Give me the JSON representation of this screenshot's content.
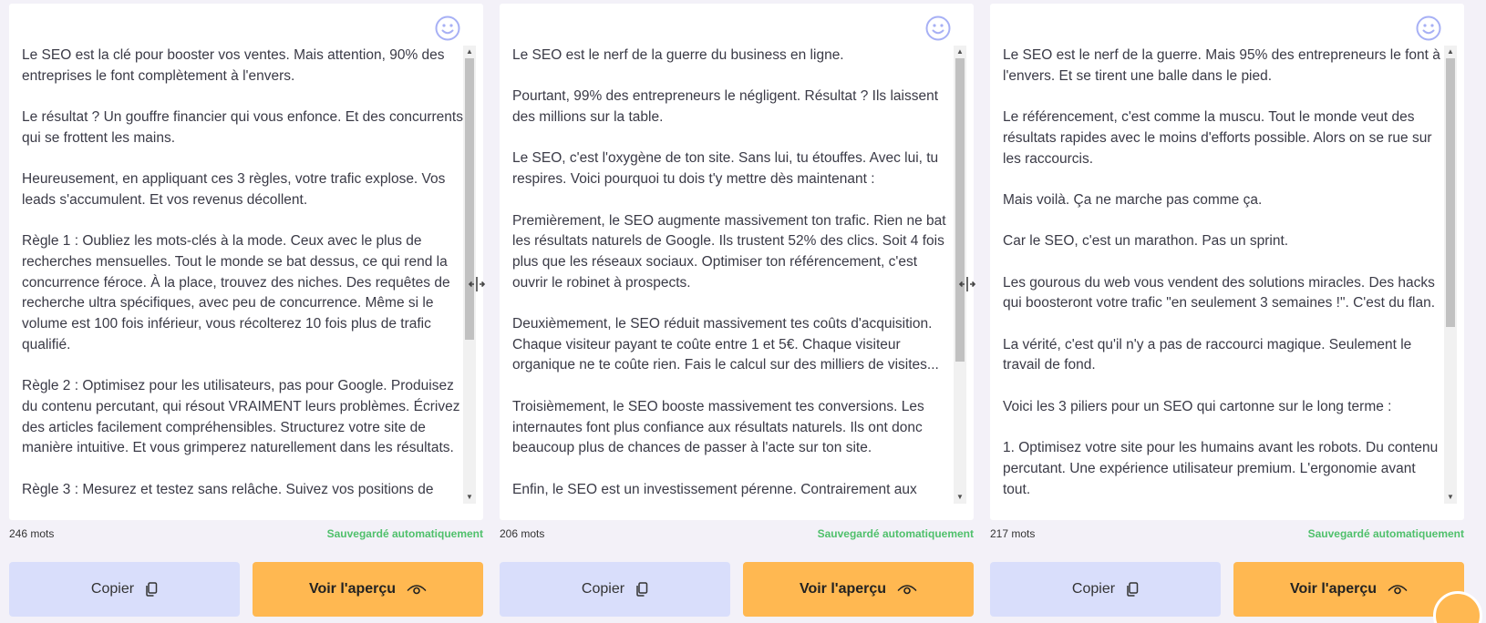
{
  "columns": [
    {
      "paragraphs": [
        "Le SEO est la clé pour booster vos ventes. Mais attention, 90% des entreprises le font complètement à l'envers.",
        "Le résultat ? Un gouffre financier qui vous enfonce. Et des concurrents qui se frottent les mains.",
        "Heureusement, en appliquant ces 3 règles, votre trafic explose. Vos leads s'accumulent. Et vos revenus décollent.",
        "Règle 1 : Oubliez les mots-clés à la mode. Ceux avec le plus de recherches mensuelles. Tout le monde se bat dessus, ce qui rend la concurrence féroce. À la place, trouvez des niches. Des requêtes de recherche ultra spécifiques, avec peu de concurrence. Même si le volume est 100 fois inférieur, vous récolterez 10 fois plus de trafic qualifié.",
        "Règle 2 : Optimisez pour les utilisateurs, pas pour Google. Produisez du contenu percutant, qui résout VRAIMENT leurs problèmes. Écrivez des articles facilement compréhensibles. Structurez votre site de manière intuitive. Et vous grimperez naturellement dans les résultats.",
        "Règle 3 : Mesurez et testez sans relâche. Suivez vos positions de"
      ],
      "word_count": "246 mots",
      "saved_label": "Sauvegardé automatiquement",
      "copy_label": "Copier",
      "preview_label": "Voir l'aperçu",
      "scroll_position": 0.0,
      "scroll_visible_fraction": 0.65
    },
    {
      "paragraphs": [
        "Le SEO est le nerf de la guerre du business en ligne.",
        "Pourtant, 99% des entrepreneurs le négligent. Résultat ? Ils laissent des millions sur la table.",
        "Le SEO, c'est l'oxygène de ton site. Sans lui, tu étouffes. Avec lui, tu respires. Voici pourquoi tu dois t'y mettre dès maintenant :",
        "Premièrement, le SEO augmente massivement ton trafic. Rien ne bat les résultats naturels de Google. Ils trustent 52% des clics. Soit 4 fois plus que les réseaux sociaux. Optimiser ton référencement, c'est ouvrir le robinet à prospects.",
        "Deuxièmement, le SEO réduit massivement tes coûts d'acquisition. Chaque visiteur payant te coûte entre 1 et 5€. Chaque visiteur organique ne te coûte rien. Fais le calcul sur des milliers de visites...",
        "Troisièmement, le SEO booste massivement tes conversions. Les internautes font plus confiance aux résultats naturels. Ils ont donc beaucoup plus de chances de passer à l'acte sur ton site.",
        "Enfin, le SEO est un investissement pérenne. Contrairement aux"
      ],
      "word_count": "206 mots",
      "saved_label": "Sauvegardé automatiquement",
      "copy_label": "Copier",
      "preview_label": "Voir l'aperçu",
      "scroll_position": 0.0,
      "scroll_visible_fraction": 0.7
    },
    {
      "paragraphs": [
        "Le SEO est le nerf de la guerre. Mais 95% des entrepreneurs le font à l'envers. Et se tirent une balle dans le pied.",
        "Le référencement, c'est comme la muscu. Tout le monde veut des résultats rapides avec le moins d'efforts possible. Alors on se rue sur les raccourcis.",
        "Mais voilà. Ça ne marche pas comme ça.",
        "Car le SEO, c'est un marathon. Pas un sprint.",
        "Les gourous du web vous vendent des solutions miracles. Des hacks qui boosteront votre trafic \"en seulement 3 semaines !\". C'est du flan.",
        "La vérité, c'est qu'il n'y a pas de raccourci magique. Seulement le travail de fond.",
        "Voici les 3 piliers pour un SEO qui cartonne sur le long terme :",
        "1. Optimisez votre site pour les humains avant les robots. Du contenu percutant. Une expérience utilisateur premium. L'ergonomie avant tout."
      ],
      "word_count": "217 mots",
      "saved_label": "Sauvegardé automatiquement",
      "copy_label": "Copier",
      "preview_label": "Voir l'aperçu",
      "scroll_position": 0.0,
      "scroll_visible_fraction": 0.62
    }
  ],
  "icons": {
    "feedback": "smiley-icon",
    "resize": "column-resize-icon",
    "copy": "copy-icon",
    "preview": "eye-icon"
  },
  "colors": {
    "background": "#f3f1f8",
    "copy_button": "#d9defb",
    "preview_button": "#ffb851",
    "saved_text": "#4fc06b",
    "smiley": "#a7b0f5"
  }
}
